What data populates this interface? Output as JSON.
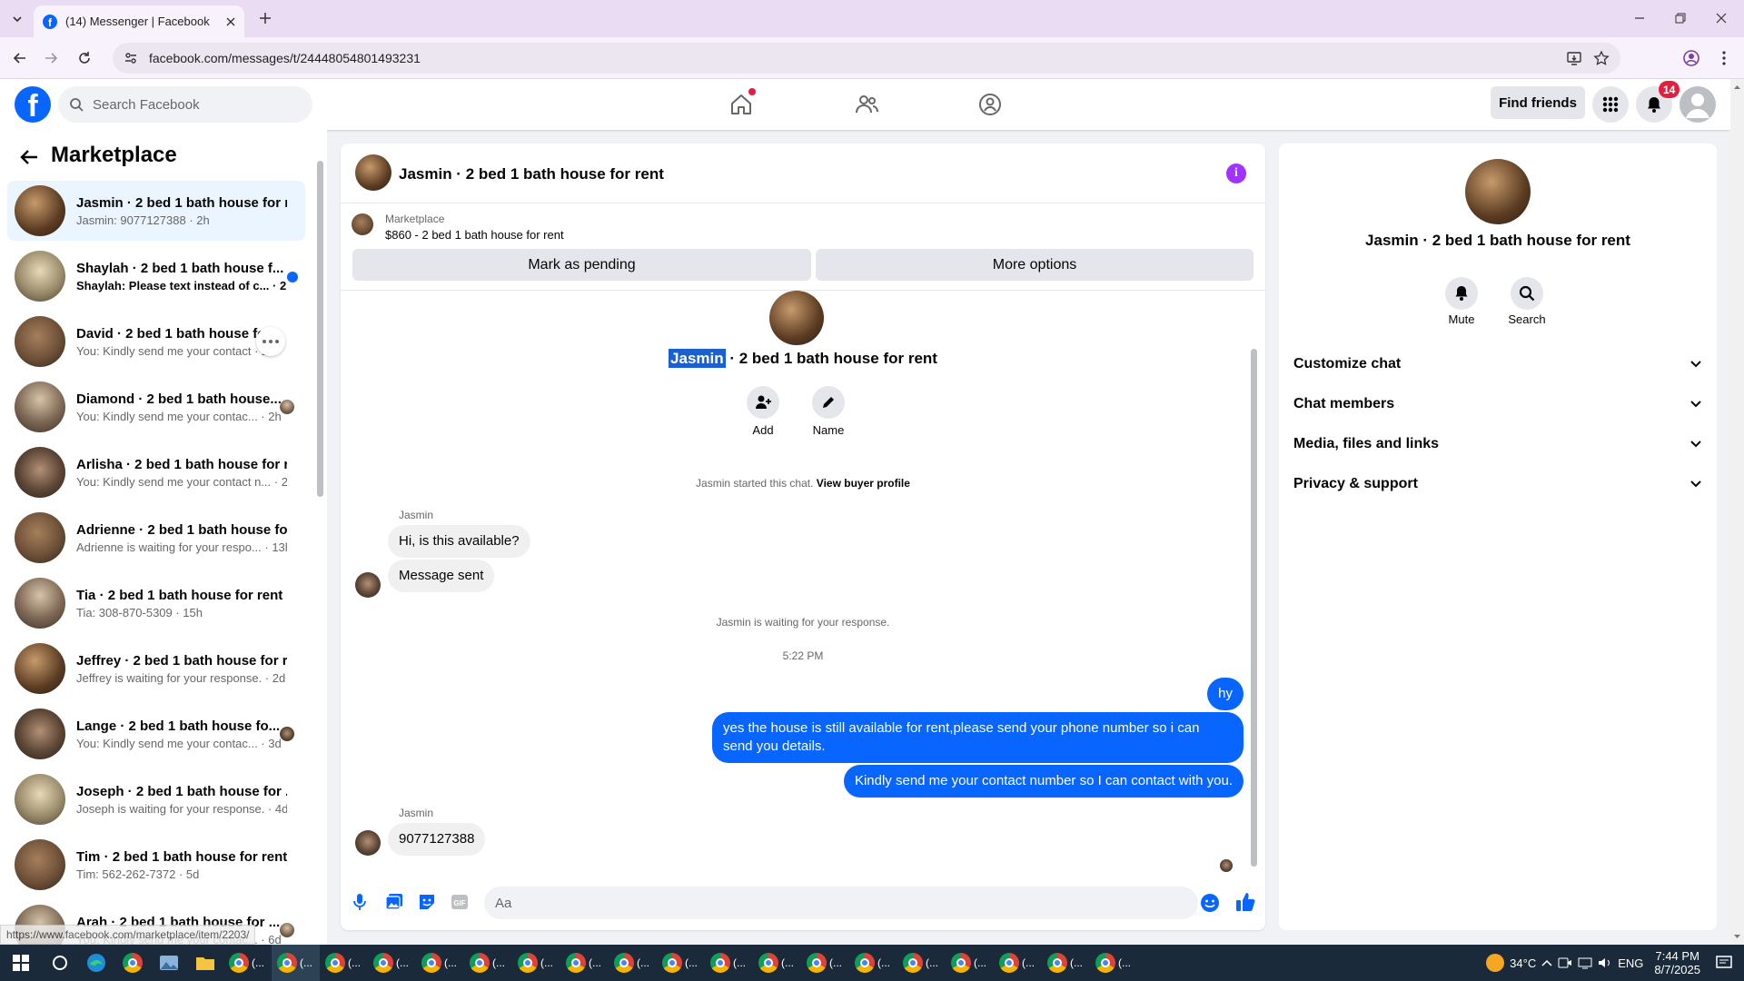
{
  "browser": {
    "tab_title": "(14) Messenger | Facebook",
    "url": "facebook.com/messages/t/24448054801493231",
    "status_url": "https://www.facebook.com/marketplace/item/2203/"
  },
  "fb": {
    "search_placeholder": "Search Facebook",
    "find_friends": "Find friends",
    "notif_count": "14"
  },
  "left": {
    "title": "Marketplace",
    "conversations": [
      {
        "name": "Jasmin · 2 bed 1 bath house for r...",
        "preview": "Jasmin: 9077127388 · 2h",
        "unread": false,
        "active": true,
        "photo": "photo1"
      },
      {
        "name": "Shaylah · 2 bed 1 bath house f...",
        "preview": "Shaylah: Please text instead of c... · 2h",
        "unread": true,
        "active": false,
        "photo": "photo2"
      },
      {
        "name": "David · 2 bed 1 bath house fo...",
        "preview": "You: Kindly send me your contact · 2h",
        "unread": false,
        "active": false,
        "photo": "photo3"
      },
      {
        "name": "Diamond · 2 bed 1 bath house...",
        "preview": "You: Kindly send me your contac... · 2h",
        "unread": false,
        "active": false,
        "photo": "photo4"
      },
      {
        "name": "Arlisha · 2 bed 1 bath house for r...",
        "preview": "You: Kindly send me your contact n... · 2h",
        "unread": false,
        "active": false,
        "photo": "photo5"
      },
      {
        "name": "Adrienne · 2 bed 1 bath house fo...",
        "preview": "Adrienne is waiting for your respo... · 13h",
        "unread": false,
        "active": false,
        "photo": "photo3"
      },
      {
        "name": "Tia · 2 bed 1 bath house for rent",
        "preview": "Tia: 308-870-5309 · 15h",
        "unread": false,
        "active": false,
        "photo": "photo4"
      },
      {
        "name": "Jeffrey · 2 bed 1 bath house for r...",
        "preview": "Jeffrey is waiting for your response. · 2d",
        "unread": false,
        "active": false,
        "photo": "photo1"
      },
      {
        "name": "Lange · 2 bed 1 bath house fo...",
        "preview": "You: Kindly send me your contac... · 3d",
        "unread": false,
        "active": false,
        "photo": "photo5"
      },
      {
        "name": "Joseph · 2 bed 1 bath house for ...",
        "preview": "Joseph is waiting for your response. · 4d",
        "unread": false,
        "active": false,
        "photo": "photo2"
      },
      {
        "name": "Tim · 2 bed 1 bath house for rent",
        "preview": "Tim: 562-262-7372 · 5d",
        "unread": false,
        "active": false,
        "photo": "photo3"
      },
      {
        "name": "Arah · 2 bed 1 bath house for ...",
        "preview": "You: Kindly send me your contac... · 6d",
        "unread": false,
        "active": false,
        "photo": "photo4"
      }
    ]
  },
  "chat": {
    "header_title": "Jasmin · 2 bed 1 bath house for rent",
    "listing_label": "Marketplace",
    "listing_title": "$860 - 2 bed 1 bath house for rent",
    "mark_pending": "Mark as pending",
    "more_options": "More options",
    "profile_name_highlight": "Jasmin",
    "profile_name_rest": " · 2 bed 1 bath house for rent",
    "add_label": "Add",
    "name_label": "Name",
    "started_text": "Jasmin started this chat.",
    "view_buyer": "View buyer profile",
    "sender1": "Jasmin",
    "msg1": "Hi, is this available?",
    "msg_sent": "Message sent",
    "waiting": "Jasmin is waiting for your response.",
    "time": "5:22 PM",
    "out1": "hy",
    "out2": "yes the house is still available for rent,please send your phone number so i can send you details.",
    "out3": "Kindly send me your contact number so I can contact with you.",
    "sender2": "Jasmin",
    "msg2": "9077127388",
    "composer_placeholder": "Aa"
  },
  "right": {
    "name": "Jasmin · 2 bed 1 bath house for rent",
    "mute": "Mute",
    "search": "Search",
    "sections": [
      "Customize chat",
      "Chat members",
      "Media, files and links",
      "Privacy & support"
    ]
  },
  "taskbar": {
    "temp": "34°C",
    "lang": "ENG",
    "time": "7:44 PM",
    "date": "8/7/2025"
  }
}
